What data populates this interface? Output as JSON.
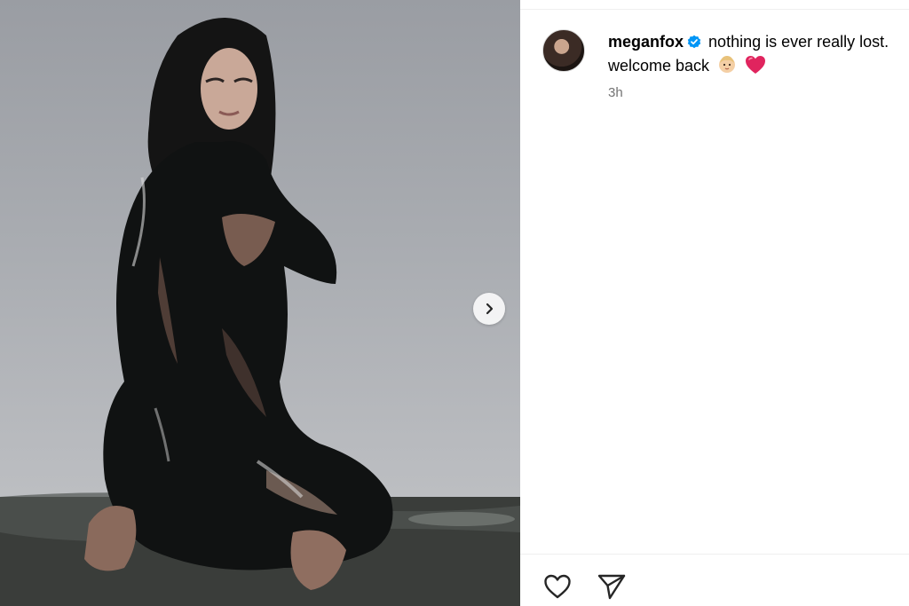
{
  "post": {
    "image_alt": "Woman kneeling, covered in black paint",
    "next_icon": "chevron-right-icon"
  },
  "author": {
    "username": "meganfox",
    "verified_icon": "verified-badge-icon"
  },
  "caption": {
    "text": "nothing is ever really lost. welcome back",
    "emojis": [
      "baby-icon",
      "red-heart-icon"
    ]
  },
  "timestamp": "3h",
  "actions": {
    "like_icon": "heart-outline-icon",
    "share_icon": "paper-plane-icon"
  },
  "colors": {
    "verified_blue": "#0095f6",
    "heart_red": "#e0245e",
    "muted_text": "#737373"
  }
}
